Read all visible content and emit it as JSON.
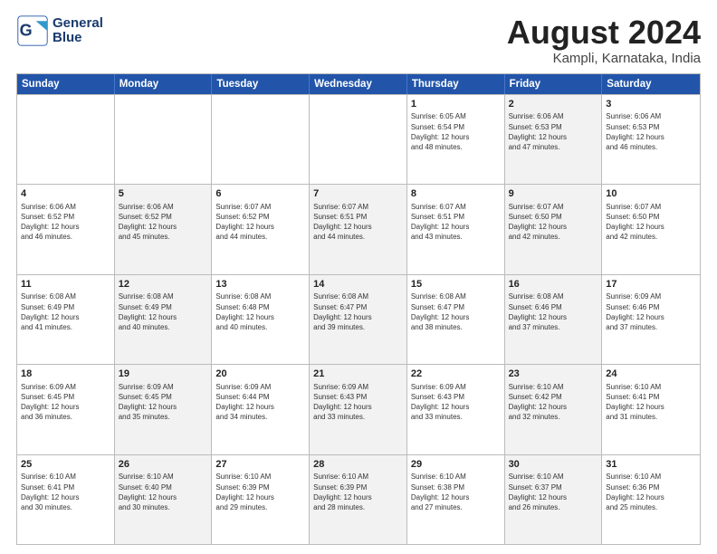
{
  "logo": {
    "line1": "General",
    "line2": "Blue"
  },
  "title": {
    "month_year": "August 2024",
    "location": "Kampli, Karnataka, India"
  },
  "weekdays": [
    "Sunday",
    "Monday",
    "Tuesday",
    "Wednesday",
    "Thursday",
    "Friday",
    "Saturday"
  ],
  "weeks": [
    [
      {
        "day": "",
        "info": "",
        "shaded": false,
        "empty": true
      },
      {
        "day": "",
        "info": "",
        "shaded": false,
        "empty": true
      },
      {
        "day": "",
        "info": "",
        "shaded": false,
        "empty": true
      },
      {
        "day": "",
        "info": "",
        "shaded": false,
        "empty": true
      },
      {
        "day": "1",
        "info": "Sunrise: 6:05 AM\nSunset: 6:54 PM\nDaylight: 12 hours\nand 48 minutes.",
        "shaded": false
      },
      {
        "day": "2",
        "info": "Sunrise: 6:06 AM\nSunset: 6:53 PM\nDaylight: 12 hours\nand 47 minutes.",
        "shaded": true
      },
      {
        "day": "3",
        "info": "Sunrise: 6:06 AM\nSunset: 6:53 PM\nDaylight: 12 hours\nand 46 minutes.",
        "shaded": false
      }
    ],
    [
      {
        "day": "4",
        "info": "Sunrise: 6:06 AM\nSunset: 6:52 PM\nDaylight: 12 hours\nand 46 minutes.",
        "shaded": false
      },
      {
        "day": "5",
        "info": "Sunrise: 6:06 AM\nSunset: 6:52 PM\nDaylight: 12 hours\nand 45 minutes.",
        "shaded": true
      },
      {
        "day": "6",
        "info": "Sunrise: 6:07 AM\nSunset: 6:52 PM\nDaylight: 12 hours\nand 44 minutes.",
        "shaded": false
      },
      {
        "day": "7",
        "info": "Sunrise: 6:07 AM\nSunset: 6:51 PM\nDaylight: 12 hours\nand 44 minutes.",
        "shaded": true
      },
      {
        "day": "8",
        "info": "Sunrise: 6:07 AM\nSunset: 6:51 PM\nDaylight: 12 hours\nand 43 minutes.",
        "shaded": false
      },
      {
        "day": "9",
        "info": "Sunrise: 6:07 AM\nSunset: 6:50 PM\nDaylight: 12 hours\nand 42 minutes.",
        "shaded": true
      },
      {
        "day": "10",
        "info": "Sunrise: 6:07 AM\nSunset: 6:50 PM\nDaylight: 12 hours\nand 42 minutes.",
        "shaded": false
      }
    ],
    [
      {
        "day": "11",
        "info": "Sunrise: 6:08 AM\nSunset: 6:49 PM\nDaylight: 12 hours\nand 41 minutes.",
        "shaded": false
      },
      {
        "day": "12",
        "info": "Sunrise: 6:08 AM\nSunset: 6:49 PM\nDaylight: 12 hours\nand 40 minutes.",
        "shaded": true
      },
      {
        "day": "13",
        "info": "Sunrise: 6:08 AM\nSunset: 6:48 PM\nDaylight: 12 hours\nand 40 minutes.",
        "shaded": false
      },
      {
        "day": "14",
        "info": "Sunrise: 6:08 AM\nSunset: 6:47 PM\nDaylight: 12 hours\nand 39 minutes.",
        "shaded": true
      },
      {
        "day": "15",
        "info": "Sunrise: 6:08 AM\nSunset: 6:47 PM\nDaylight: 12 hours\nand 38 minutes.",
        "shaded": false
      },
      {
        "day": "16",
        "info": "Sunrise: 6:08 AM\nSunset: 6:46 PM\nDaylight: 12 hours\nand 37 minutes.",
        "shaded": true
      },
      {
        "day": "17",
        "info": "Sunrise: 6:09 AM\nSunset: 6:46 PM\nDaylight: 12 hours\nand 37 minutes.",
        "shaded": false
      }
    ],
    [
      {
        "day": "18",
        "info": "Sunrise: 6:09 AM\nSunset: 6:45 PM\nDaylight: 12 hours\nand 36 minutes.",
        "shaded": false
      },
      {
        "day": "19",
        "info": "Sunrise: 6:09 AM\nSunset: 6:45 PM\nDaylight: 12 hours\nand 35 minutes.",
        "shaded": true
      },
      {
        "day": "20",
        "info": "Sunrise: 6:09 AM\nSunset: 6:44 PM\nDaylight: 12 hours\nand 34 minutes.",
        "shaded": false
      },
      {
        "day": "21",
        "info": "Sunrise: 6:09 AM\nSunset: 6:43 PM\nDaylight: 12 hours\nand 33 minutes.",
        "shaded": true
      },
      {
        "day": "22",
        "info": "Sunrise: 6:09 AM\nSunset: 6:43 PM\nDaylight: 12 hours\nand 33 minutes.",
        "shaded": false
      },
      {
        "day": "23",
        "info": "Sunrise: 6:10 AM\nSunset: 6:42 PM\nDaylight: 12 hours\nand 32 minutes.",
        "shaded": true
      },
      {
        "day": "24",
        "info": "Sunrise: 6:10 AM\nSunset: 6:41 PM\nDaylight: 12 hours\nand 31 minutes.",
        "shaded": false
      }
    ],
    [
      {
        "day": "25",
        "info": "Sunrise: 6:10 AM\nSunset: 6:41 PM\nDaylight: 12 hours\nand 30 minutes.",
        "shaded": false
      },
      {
        "day": "26",
        "info": "Sunrise: 6:10 AM\nSunset: 6:40 PM\nDaylight: 12 hours\nand 30 minutes.",
        "shaded": true
      },
      {
        "day": "27",
        "info": "Sunrise: 6:10 AM\nSunset: 6:39 PM\nDaylight: 12 hours\nand 29 minutes.",
        "shaded": false
      },
      {
        "day": "28",
        "info": "Sunrise: 6:10 AM\nSunset: 6:39 PM\nDaylight: 12 hours\nand 28 minutes.",
        "shaded": true
      },
      {
        "day": "29",
        "info": "Sunrise: 6:10 AM\nSunset: 6:38 PM\nDaylight: 12 hours\nand 27 minutes.",
        "shaded": false
      },
      {
        "day": "30",
        "info": "Sunrise: 6:10 AM\nSunset: 6:37 PM\nDaylight: 12 hours\nand 26 minutes.",
        "shaded": true
      },
      {
        "day": "31",
        "info": "Sunrise: 6:10 AM\nSunset: 6:36 PM\nDaylight: 12 hours\nand 25 minutes.",
        "shaded": false
      }
    ]
  ]
}
